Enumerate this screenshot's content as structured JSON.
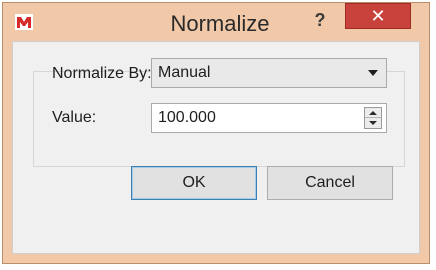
{
  "window": {
    "title": "Normalize",
    "help_label": "?",
    "close_label": "✕",
    "app_icon": "app-logo-icon",
    "colors": {
      "frame": "#f1c9a8",
      "close": "#c8413a",
      "client": "#f0f0f0"
    }
  },
  "form": {
    "normalize_by_label": "Normalize By:",
    "normalize_by_value": "Manual",
    "value_label": "Value:",
    "value": "100.000"
  },
  "buttons": {
    "ok": "OK",
    "cancel": "Cancel"
  }
}
